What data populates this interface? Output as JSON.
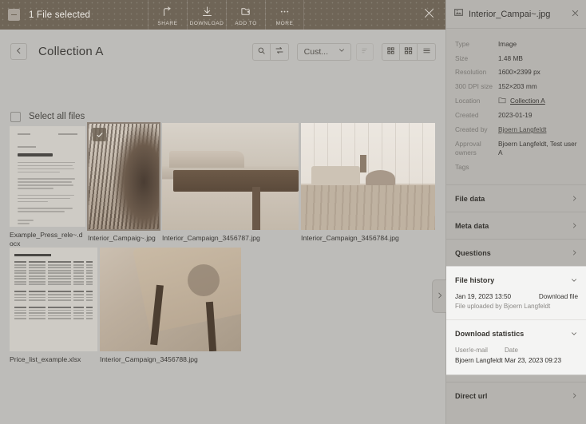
{
  "selection_bar": {
    "count_label": "1 File selected",
    "checkbox_state": "indeterminate",
    "actions": [
      {
        "label": "SHARE",
        "icon": "share-icon"
      },
      {
        "label": "DOWNLOAD",
        "icon": "download-icon"
      },
      {
        "label": "ADD TO",
        "icon": "add-to-folder-icon"
      },
      {
        "label": "MORE",
        "icon": "more-dots-icon"
      }
    ],
    "close_icon": "close-icon"
  },
  "collection_header": {
    "back_icon": "chevron-left-icon",
    "title": "Collection A",
    "tools": {
      "search_icon": "search-icon",
      "filter_icon": "filter-swap-icon",
      "sort_value": "Cust...",
      "sort_chevron": "chevron-down-icon",
      "sort_direction_icon": "sort-ascending-icon",
      "view_grid_small_icon": "grid-small-icon",
      "view_grid_large_icon": "grid-large-icon",
      "view_list_icon": "list-view-icon"
    }
  },
  "select_all": {
    "label": "Select all files",
    "checked": false
  },
  "files": [
    {
      "name": "Example_Press_rele~.docx",
      "type": "document",
      "selected": false
    },
    {
      "name": "Interior_Campaig~.jpg",
      "type": "image",
      "selected": true
    },
    {
      "name": "Interior_Campaign_3456787.jpg",
      "type": "image",
      "selected": false
    },
    {
      "name": "Interior_Campaign_3456784.jpg",
      "type": "image",
      "selected": false
    },
    {
      "name": "Price_list_example.xlsx",
      "type": "spreadsheet",
      "selected": false
    },
    {
      "name": "Interior_Campaign_3456788.jpg",
      "type": "image",
      "selected": false
    }
  ],
  "panel_handle": {
    "icon": "chevron-right-icon"
  },
  "side_panel": {
    "file_icon": "image-file-icon",
    "title": "Interior_Campai~.jpg",
    "close_icon": "close-icon",
    "metadata": [
      {
        "key": "Type",
        "value": "Image"
      },
      {
        "key": "Size",
        "value": "1.48 MB"
      },
      {
        "key": "Resolution",
        "value": "1600×2399 px"
      },
      {
        "key": "300 DPI size",
        "value": "152×203 mm"
      },
      {
        "key": "Location",
        "value": "Collection A",
        "icon": "folder-icon",
        "link": true
      },
      {
        "key": "Created",
        "value": "2023-01-19"
      },
      {
        "key": "Created by",
        "value": "Bjoern Langfeldt",
        "link": true
      },
      {
        "key": "Approval owners",
        "value": "Bjoern Langfeldt, Test user A"
      },
      {
        "key": "Tags",
        "value": ""
      }
    ],
    "sections": [
      {
        "title": "File data",
        "expanded": false,
        "chevron": "chevron-right-icon"
      },
      {
        "title": "Meta data",
        "expanded": false,
        "chevron": "chevron-right-icon"
      },
      {
        "title": "Questions",
        "expanded": false,
        "chevron": "chevron-right-icon"
      },
      {
        "title": "Direct url",
        "expanded": false,
        "chevron": "chevron-right-icon"
      }
    ],
    "file_history": {
      "title": "File history",
      "chevron": "chevron-down-icon",
      "entries": [
        {
          "date": "Jan 19, 2023 13:50",
          "action": "Download file",
          "detail": "File uploaded by Bjoern Langfeldt"
        }
      ]
    },
    "download_statistics": {
      "title": "Download statistics",
      "chevron": "chevron-down-icon",
      "columns": [
        "User/e-mail",
        "Date"
      ],
      "rows": [
        {
          "user": "Bjoern Langfeldt",
          "date": "Mar 23, 2023 09:23"
        }
      ]
    }
  },
  "colors": {
    "selection_bar_bg": "#6f6557",
    "page_bg": "#bdbcb9",
    "panel_bg": "#b5b3af",
    "card_bg": "#f4f4f3",
    "text_primary": "#3c3a37",
    "text_muted": "#7c7a76"
  }
}
